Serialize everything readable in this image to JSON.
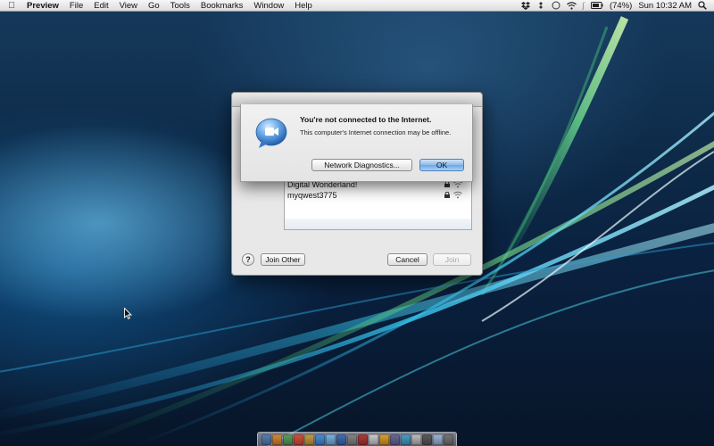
{
  "menubar": {
    "app_name": "Preview",
    "items": [
      "File",
      "Edit",
      "View",
      "Go",
      "Tools",
      "Bookmarks",
      "Window",
      "Help"
    ],
    "battery": "(74%)",
    "clock": "Sun 10:32 AM",
    "status_icons": [
      "dropbox-icon",
      "sync-icon",
      "time-machine-icon",
      "wifi-icon",
      "bluetooth-icon",
      "battery-icon",
      "search-icon"
    ]
  },
  "network_window": {
    "networks": [
      {
        "name": "Digital Wonderland!",
        "secured": true
      },
      {
        "name": "myqwest3775",
        "secured": true
      }
    ],
    "help_label": "?",
    "join_other_label": "Join Other",
    "cancel_label": "Cancel",
    "join_label": "Join"
  },
  "alert": {
    "title": "You're not connected to the Internet.",
    "message": "This computer's Internet connection may be offline.",
    "diagnostics_label": "Network Diagnostics...",
    "ok_label": "OK",
    "icon": "ichat-icon"
  },
  "dock": {
    "icon_colors": [
      "#5a7fb3",
      "#d98b3a",
      "#5fa05f",
      "#d9523d",
      "#c8a040",
      "#4a90d9",
      "#7bb6e6",
      "#3f6fb5",
      "#888888",
      "#b23a3a",
      "#cfcfcf",
      "#e0a030",
      "#6a6a9a",
      "#4aa0c8",
      "#c0c0c0",
      "#5c5c5c",
      "#9fb9d9",
      "#777777"
    ]
  },
  "colors": {
    "ok_button": "#6ea7e3",
    "wallpaper_dark": "#0a2140",
    "wallpaper_glow": "#4fd8f0"
  }
}
